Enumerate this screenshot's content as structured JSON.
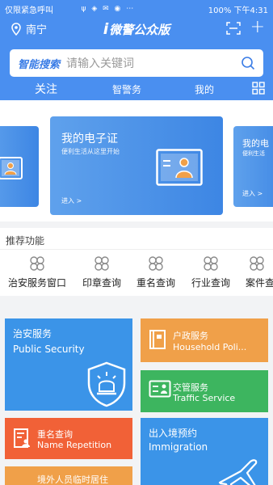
{
  "status_bar": {
    "left_text": "仅限紧急呼叫",
    "battery": "100%",
    "time": "下午4:31"
  },
  "header": {
    "location": "南宁",
    "app_title_prefix": "i",
    "app_title": "微警公众版"
  },
  "search": {
    "brand": "智能搜索",
    "placeholder": "请输入关键词"
  },
  "tabs": [
    {
      "label": "关注",
      "active": true
    },
    {
      "label": "智警务",
      "active": false
    },
    {
      "label": "我的",
      "active": false
    }
  ],
  "carousel": {
    "main": {
      "title": "我的电子证",
      "subtitle": "便利生活从这里开始",
      "enter": "进入 >"
    },
    "right": {
      "title": "我的电",
      "subtitle": "便利生活",
      "enter": "进入 >"
    }
  },
  "recommended": {
    "title": "推荐功能",
    "items": [
      {
        "label": "治安服务窗口"
      },
      {
        "label": "印章查询"
      },
      {
        "label": "重名查询"
      },
      {
        "label": "行业查询"
      },
      {
        "label": "案件查"
      }
    ]
  },
  "tiles": {
    "public_security": {
      "cn": "治安服务",
      "en": "Public Security"
    },
    "household": {
      "cn": "户政服务",
      "en": "Household Poli..."
    },
    "traffic": {
      "cn": "交管服务",
      "en": "Traffic Service"
    },
    "name_repetition": {
      "cn": "重名查询",
      "en": "Name Repetition"
    },
    "immigration": {
      "cn": "出入境预约",
      "en": "Immigration"
    },
    "temporary": {
      "cn": "境外人员临时居住"
    }
  },
  "colors": {
    "primary": "#4a8ff0",
    "tile_blue": "#3b94e8",
    "tile_orange": "#f0a049",
    "tile_green": "#3db55f",
    "tile_red": "#f16137"
  }
}
